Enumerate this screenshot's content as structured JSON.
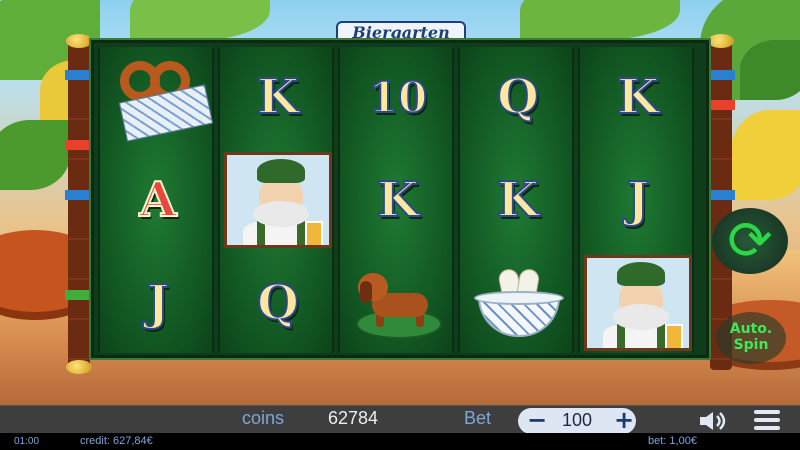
{
  "game": {
    "logo": "Biergarten"
  },
  "reels": [
    [
      "pretzel",
      "A",
      "J"
    ],
    [
      "K",
      "portrait",
      "Q"
    ],
    [
      "10",
      "K",
      "dachshund"
    ],
    [
      "Q",
      "K",
      "weisswurst"
    ],
    [
      "K",
      "J",
      "portrait"
    ]
  ],
  "controls": {
    "spin_icon": "spin-arrows-icon",
    "auto_spin_line1": "Auto.",
    "auto_spin_line2": "Spin"
  },
  "bottom_bar": {
    "coins_label": "coins",
    "coins_value": "62784",
    "bet_label": "Bet",
    "bet_value": "100",
    "minus": "−",
    "plus": "+",
    "sound_icon": "speaker-icon",
    "menu_icon": "hamburger-menu-icon"
  },
  "status_bar": {
    "time": "01:00",
    "credit": "credit: 627,84€",
    "bet": "bet: 1,00€"
  },
  "colors": {
    "reel_green": "#135a24",
    "spin_green": "#2fd44a",
    "label_blue": "#7ea6d8"
  }
}
